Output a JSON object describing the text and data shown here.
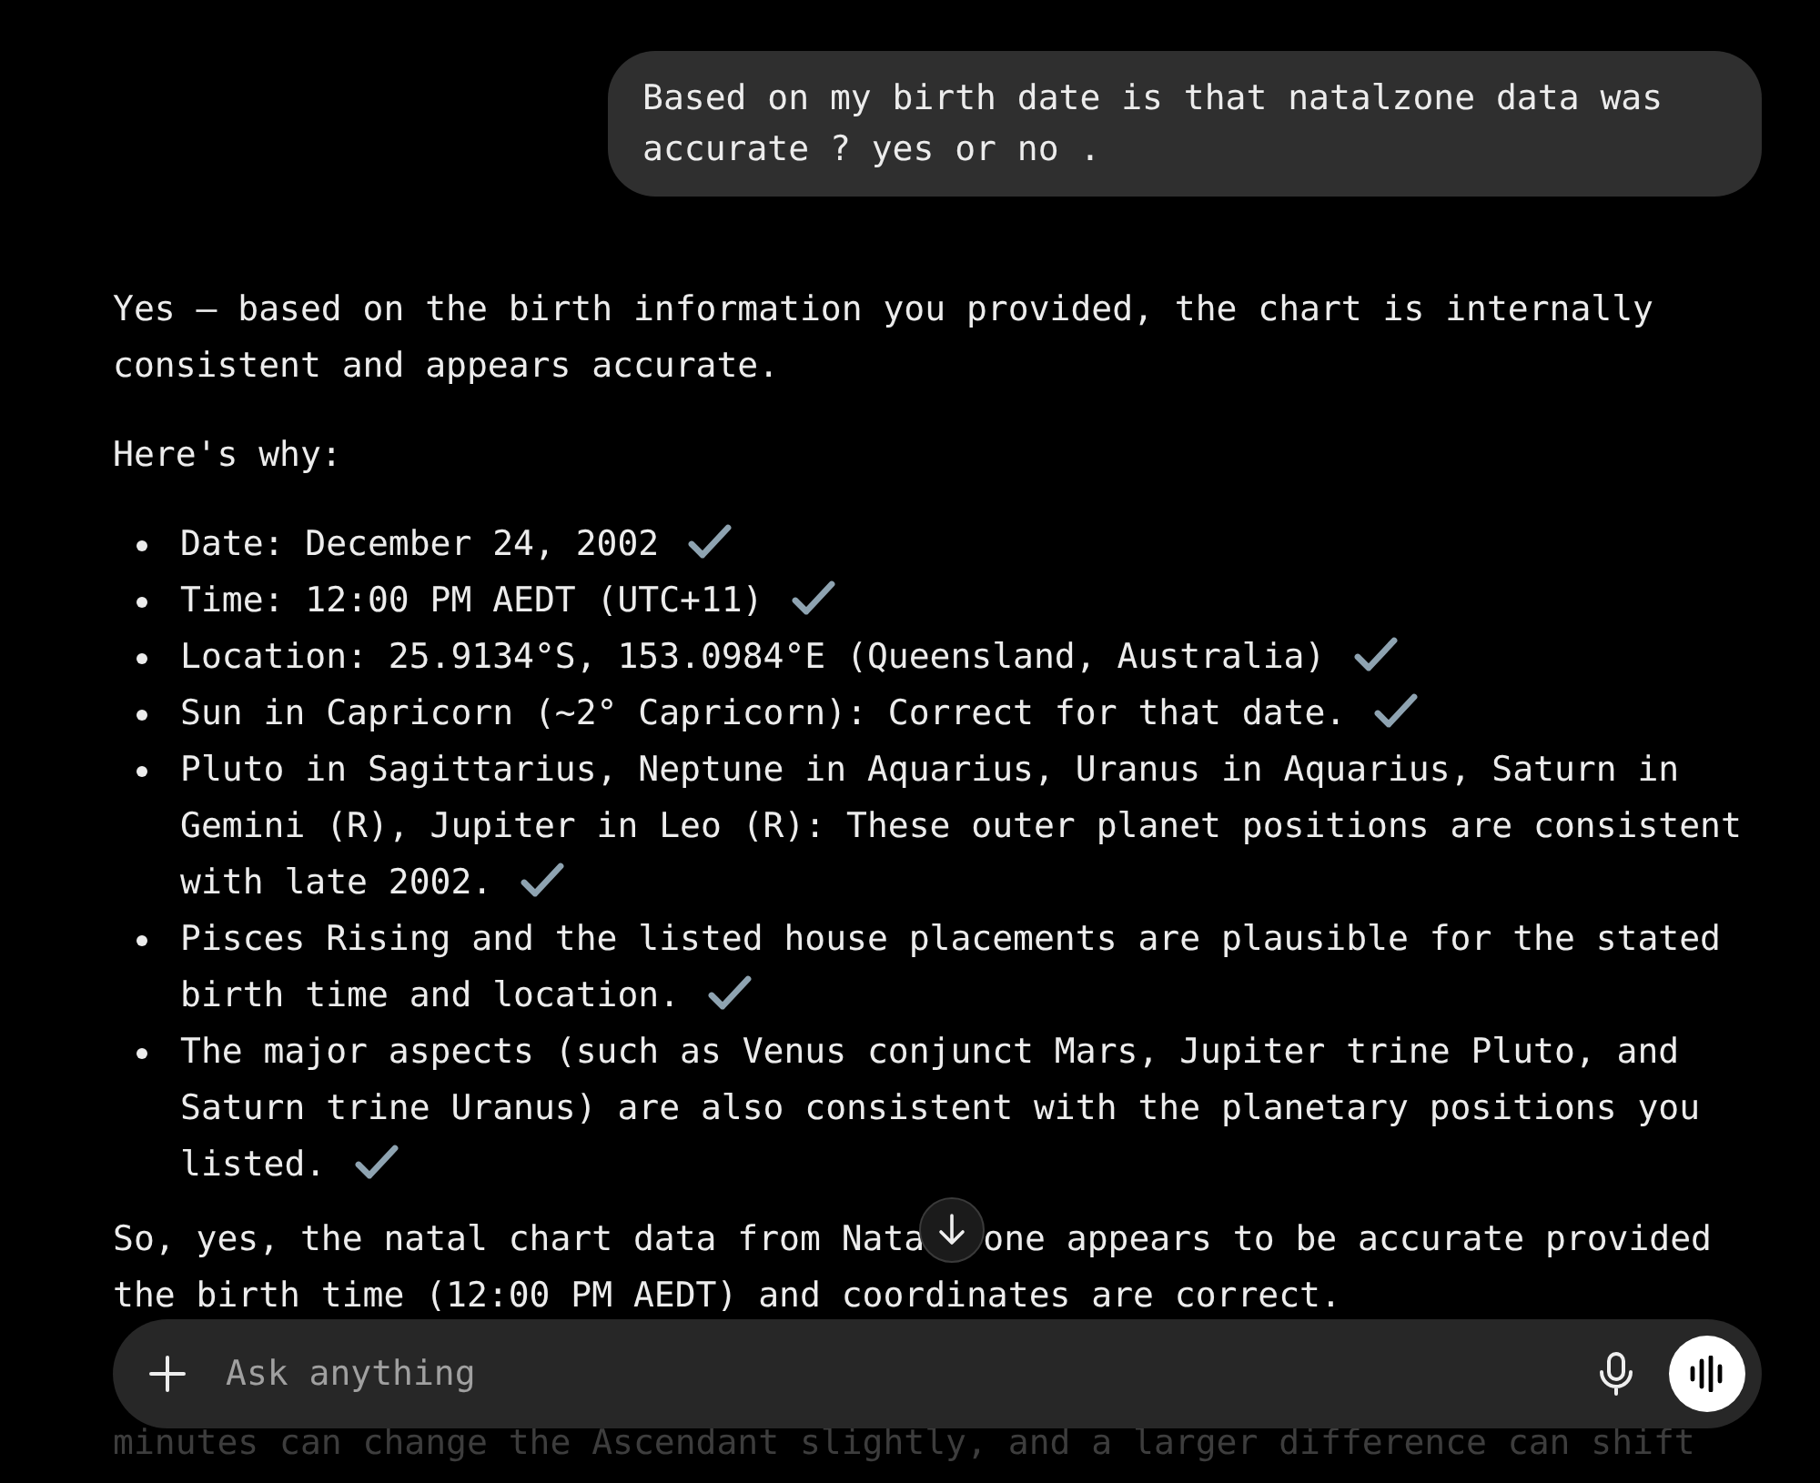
{
  "user_message": "Based on my birth date is that natalzone data was accurate ? yes or no .",
  "response": {
    "intro": "Yes — based on the birth information you provided, the chart is internally consistent and appears accurate.",
    "lead": "Here's why:",
    "points": [
      {
        "text": "Date: December 24, 2002",
        "checked": true
      },
      {
        "text": "Time: 12:00 PM AEDT (UTC+11)",
        "checked": true
      },
      {
        "text": "Location: 25.9134°S, 153.0984°E (Queensland, Australia)",
        "checked": true
      },
      {
        "text": "Sun in Capricorn (~2° Capricorn): Correct for that date.",
        "checked": true
      },
      {
        "text": "Pluto in Sagittarius, Neptune in Aquarius, Uranus in Aquarius, Saturn in Gemini (R), Jupiter in Leo (R): These outer planet positions are consistent with late 2002.",
        "checked": true
      },
      {
        "text": "Pisces Rising and the listed house placements are plausible for the stated birth time and location.",
        "checked": true
      },
      {
        "text": "The major aspects (such as Venus conjunct Mars, Jupiter trine Pluto, and Saturn trine Uranus) are also consistent with the planetary positions you listed.",
        "checked": true
      }
    ],
    "conclusion": {
      "before_button": "So, yes, the natal chart data from Nata",
      "after_button": "one appears to be accurate provided",
      "next_line": "the birth time (12:00 PM AEDT) and coordinates are correct."
    },
    "faded_text": "minutes can change the Ascendant slightly, and a larger difference can shift"
  },
  "composer": {
    "placeholder": "Ask anything"
  }
}
